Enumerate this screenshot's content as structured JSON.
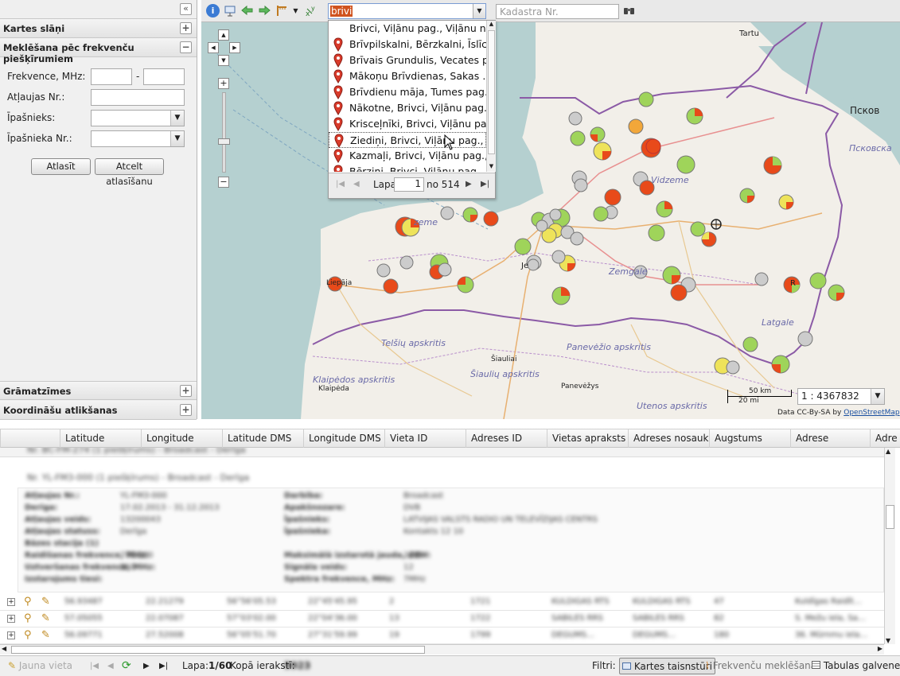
{
  "left_panel": {
    "collapse_icon": "double-chevron-left",
    "kartes_slani": "Kartes slāņi",
    "meklesana": "Meklēšana pēc frekvenču piešķīrumiem",
    "frekvence_label": "Frekvence, MHz:",
    "range_dash": "-",
    "atlaujas_label": "Atļaujas Nr.:",
    "ipasnieks_label": "Īpašnieks:",
    "ipasnieka_nr_label": "Īpašnieka Nr.:",
    "atlasit": "Atlasīt",
    "atcelt": "Atcelt atlasīšanu",
    "gramatzimes": "Grāmatzīmes",
    "koordinatu": "Koordināšu atlikšanas"
  },
  "toolbar": {
    "search_value": "brivi",
    "kadastra_placeholder": "Kadastra Nr."
  },
  "dropdown": {
    "items": [
      "Brivci, Viļānu pag., Viļānu nov.",
      "Brīvpilskalni, Bērzkalni, Īslīc…",
      "Brīvais Grundulis, Vecates p…",
      "Mākoņu Brīvdienas, Sakas …",
      "Brīvdienu māja, Tumes pag.…",
      "Nākotne, Brivci, Viļānu pag.,…",
      "Krisceļnīki, Brivci, Viļānu pa…",
      "Ziediņi, Brivci, Viļānu pag., …",
      "Kazmaļi, Brivci, Viļānu pag.,…",
      "Bērziņi, Brivci, Viļānu pag.,…"
    ],
    "pager_label": "Lapa",
    "page_value": "1",
    "page_of": "no 514"
  },
  "map": {
    "labels": {
      "tartu": "Tartu",
      "pskov": "Псков",
      "pskovskaya": "Псковска",
      "vidzeme": "Vidzeme",
      "kurzeme": "zeme",
      "zemgale": "Zemgale",
      "latgale": "Latgale",
      "jelgava": "Je",
      "liepaja": "Liepāja",
      "telsiu": "Telšių apskritis",
      "siauliu_city": "Šiauliai",
      "siauliu": "Šiaulių apskritis",
      "panevezio": "Panevėžio apskritis",
      "panevezys": "Panevėžys",
      "klaipedos": "Klaipėdos apskritis",
      "klaipeda": "Klaipėda",
      "utenos": "Utenos apskritis",
      "rezekne": "R"
    },
    "scale_km": "50 km",
    "scale_mi": "20 mi",
    "scale_value": "1 : 4367832",
    "attribution": "Data CC-By-SA by",
    "attribution_link": "OpenStreetMap"
  },
  "grid": {
    "columns": [
      "Latitude",
      "Longitude",
      "Latitude DMS",
      "Longitude DMS",
      "Vieta ID",
      "Adreses ID",
      "Vietas apraksts",
      "Adreses nosauk…",
      "Augstums",
      "Adrese",
      "Adre"
    ],
    "group1": "Nr. BC-FM-274 (1 piešķīrums) - Broadcast - Derīga",
    "group2": "Nr. YL-FM3-000 (1 piešķīrums) - Broadcast - Derīga",
    "detail": [
      [
        "Atļaujas Nr.:",
        "YL-FM3-000",
        "Darbība:",
        "Broadcast"
      ],
      [
        "Derīga:",
        "17.02.2013 - 31.12.2013",
        "Apakšnozare:",
        "DVB"
      ],
      [
        "Atļaujas veids:",
        "13200043",
        "Īpašnieks:",
        "LATVIJAS VALSTS RADIO UN TELEVĪZIJAS CENTRS"
      ],
      [
        "Atļaujas statuss:",
        "Derīga",
        "Īpašnieka:",
        "Kontakts 12 10"
      ],
      [
        "Bāzes stacija (1)",
        "",
        "",
        ""
      ],
      [
        "Raidīšanas frekvence, MHz:",
        "770.000",
        "Maksimālā izstarotā jauda, dBW:",
        "22.0"
      ],
      [
        "Uztveršanas frekvence, MHz:",
        "860",
        "Signāla veids:",
        "12"
      ],
      [
        "Izstarojums tiesi:",
        "",
        "Spektra frekvence, MHz:",
        "7MHz"
      ]
    ],
    "rows": [
      [
        "56.93487",
        "22.21279",
        "56°56'05.53",
        "22°45'45.95",
        "2",
        "1721",
        "KULDĪGAS RTS",
        "KULDĪGAS RTS",
        "47",
        "Kuldīgas Raidīt…"
      ],
      [
        "57.05055",
        "22.07087",
        "57°03'02.00",
        "22°04'36.00",
        "13",
        "1722",
        "SABILES RRS",
        "SABILES RRS",
        "82",
        "S. Mežu iela, Sa…"
      ],
      [
        "56.09771",
        "27.52008",
        "56°05'51.70",
        "27°31'59.99",
        "19",
        "1799",
        "DEGUMS…",
        "DEGUMS…",
        "180",
        "36. Mūrnmu iela…"
      ]
    ]
  },
  "status": {
    "jauna_vieta": "Jauna vieta",
    "lapa": "Lapa:",
    "page": "1/60",
    "kopa": "Kopā ierakstī:",
    "total": "5923",
    "filtri": "Filtri:",
    "f1": "Kartes taisnstūri",
    "f2": "Frekvenču meklēšana",
    "f3": "Tabulas galvene"
  }
}
